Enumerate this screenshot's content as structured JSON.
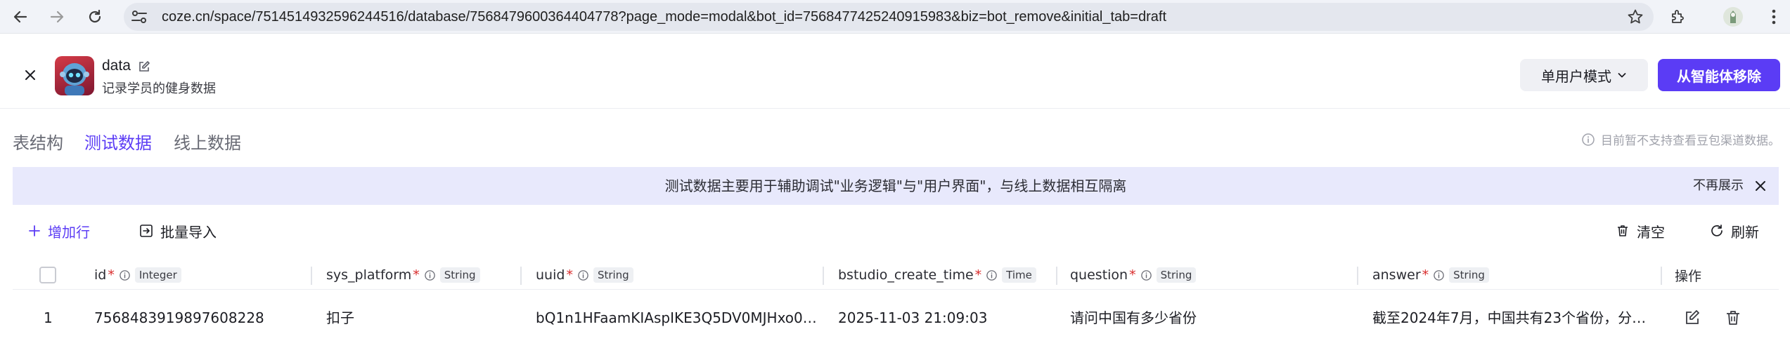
{
  "browser": {
    "url": "coze.cn/space/7514514932596244516/database/7568479600364404778?page_mode=modal&bot_id=7568477425240915983&biz=bot_remove&initial_tab=draft"
  },
  "header": {
    "title": "data",
    "description": "记录学员的健身数据",
    "mode_label": "单用户模式",
    "remove_label": "从智能体移除"
  },
  "tabs": [
    {
      "label": "表结构",
      "active": false
    },
    {
      "label": "测试数据",
      "active": true
    },
    {
      "label": "线上数据",
      "active": false
    }
  ],
  "tab_note": "目前暂不支持查看豆包渠道数据。",
  "banner": {
    "text": "测试数据主要用于辅助调试\"业务逻辑\"与\"用户界面\"，与线上数据相互隔离",
    "dismiss_label": "不再展示"
  },
  "toolbar": {
    "add_row": "增加行",
    "bulk_import": "批量导入",
    "clear": "清空",
    "refresh": "刷新"
  },
  "columns": [
    {
      "name": "id",
      "type": "Integer"
    },
    {
      "name": "sys_platform",
      "type": "String"
    },
    {
      "name": "uuid",
      "type": "String"
    },
    {
      "name": "bstudio_create_time",
      "type": "Time"
    },
    {
      "name": "question",
      "type": "String"
    },
    {
      "name": "answer",
      "type": "String"
    }
  ],
  "actions_header": "操作",
  "rows": [
    {
      "index": "1",
      "id": "7568483919897608228",
      "sys_platform": "扣子",
      "uuid": "bQ1n1HFaamKIAspIKE3Q5DV0MJHxo0…",
      "bstudio_create_time": "2025-11-03 21:09:03",
      "question": "请问中国有多少省份",
      "answer": "截至2024年7月，中国共有23个省份，分…"
    }
  ],
  "colors": {
    "accent": "#5b3cf5",
    "banner_bg": "#e8e9fc",
    "required": "#d92b2b"
  }
}
